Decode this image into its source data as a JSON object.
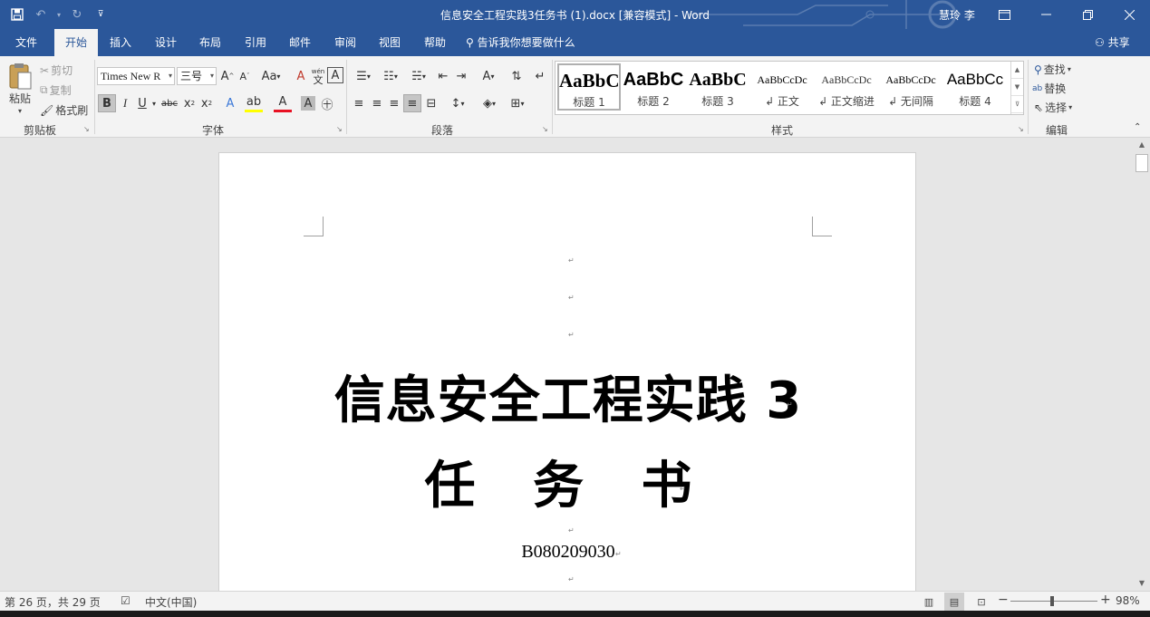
{
  "title_bar": {
    "doc_title": "信息安全工程实践3任务书 (1).docx [兼容模式]  -  Word",
    "user": "慧玲 李",
    "qat_icons": [
      "save-icon",
      "undo-icon",
      "redo-icon",
      "customize-icon"
    ],
    "window_buttons": [
      "ribbon-display-options-icon",
      "minimize-icon",
      "restore-icon",
      "close-icon"
    ]
  },
  "tabs": [
    {
      "label": "文件"
    },
    {
      "label": "开始",
      "active": true
    },
    {
      "label": "插入"
    },
    {
      "label": "设计"
    },
    {
      "label": "布局"
    },
    {
      "label": "引用"
    },
    {
      "label": "邮件"
    },
    {
      "label": "审阅"
    },
    {
      "label": "视图"
    },
    {
      "label": "帮助"
    }
  ],
  "tell_me": "告诉我你想要做什么",
  "share": "共享",
  "ribbon": {
    "clipboard": {
      "label": "剪贴板",
      "paste": "粘贴",
      "cut": "剪切",
      "copy": "复制",
      "format_painter": "格式刷"
    },
    "font": {
      "label": "字体",
      "font_name": "Times New R",
      "font_size": "三号",
      "aa_label": "Aa",
      "wen_label": "wén",
      "phonetic_char": "文"
    },
    "paragraph": {
      "label": "段落"
    },
    "styles": {
      "label": "样式",
      "items": [
        {
          "sample": "AaBbC",
          "name": "标题 1"
        },
        {
          "sample": "AaBbC",
          "name": "标题 2"
        },
        {
          "sample": "AaBbC",
          "name": "标题 3"
        },
        {
          "sample": "AaBbCcDc",
          "name": "↲ 正文"
        },
        {
          "sample": "AaBbCcDc",
          "name": "↲ 正文缩进"
        },
        {
          "sample": "AaBbCcDc",
          "name": "↲ 无间隔"
        },
        {
          "sample": "AaBbCc",
          "name": "标题 4"
        }
      ]
    },
    "editing": {
      "label": "编辑",
      "find": "查找",
      "replace": "替换",
      "select": "选择"
    }
  },
  "document": {
    "title": "信息安全工程实践 3",
    "subtitle": "任 务 书",
    "code": "B080209030",
    "paragraph_mark": "↵"
  },
  "status_bar": {
    "page_info": "第 26 页，共 29 页",
    "language": "中文(中国)",
    "zoom": "98%"
  }
}
